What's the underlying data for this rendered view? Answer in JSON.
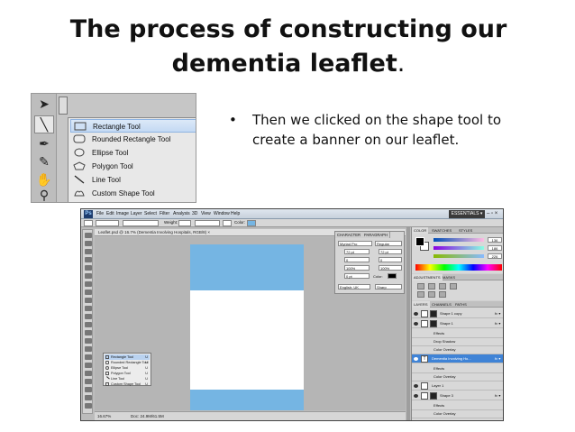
{
  "slide": {
    "title_line1": "The process of constructing our",
    "title_line2": "dementia leaflet",
    "title_period": ".",
    "bullet_marker": "•",
    "bullet_text": "Then we clicked on the shape tool to create a banner on our leaflet."
  },
  "shape_flyout": {
    "items": [
      {
        "label": "Rectangle Tool",
        "key": "U",
        "icon": "rectangle-icon",
        "selected": true
      },
      {
        "label": "Rounded Rectangle Tool",
        "key": "U",
        "icon": "rounded-rectangle-icon",
        "selected": false
      },
      {
        "label": "Ellipse Tool",
        "key": "U",
        "icon": "ellipse-icon",
        "selected": false
      },
      {
        "label": "Polygon Tool",
        "key": "U",
        "icon": "polygon-icon",
        "selected": false
      },
      {
        "label": "Line Tool",
        "key": "U",
        "icon": "line-icon",
        "selected": false
      },
      {
        "label": "Custom Shape Tool",
        "key": "U",
        "icon": "custom-shape-icon",
        "selected": false
      }
    ],
    "tool_icons": [
      "arrow-icon",
      "pen-icon",
      "line-tool-icon",
      "brush-icon",
      "hand-icon",
      "zoom-icon"
    ]
  },
  "photoshop": {
    "logo": "Ps",
    "menus": [
      "File",
      "Edit",
      "Image",
      "Layer",
      "Select",
      "Filter",
      "Analysis",
      "3D",
      "View",
      "Window",
      "Help"
    ],
    "workspace": "ESSENTIALS ▾",
    "window_controls": "– ▫ ×",
    "options": {
      "weight_label": "Weight:",
      "color_label": "Color:"
    },
    "doc_tab": "Leaflet.psd @ 16.7% (Dementia Involving Hospitals, RGB/8) ×",
    "status": {
      "zoom": "16.67%",
      "doc": "Doc: 24.9M/61.5M"
    },
    "flyout_items": [
      {
        "label": "Rectangle Tool",
        "key": "U"
      },
      {
        "label": "Rounded Rectangle Tool",
        "key": "U"
      },
      {
        "label": "Ellipse Tool",
        "key": "U"
      },
      {
        "label": "Polygon Tool",
        "key": "U"
      },
      {
        "label": "Line Tool",
        "key": "U"
      },
      {
        "label": "Custom Shape Tool",
        "key": "U"
      }
    ],
    "character_panel": {
      "tabs": [
        "CHARACTER",
        "PARAGRAPH"
      ],
      "font": "Myriad Pro",
      "style": "Regular",
      "size": "72 pt",
      "leading": "72 pt",
      "kerning": "0",
      "tracking": "0",
      "vscale": "100%",
      "hscale": "100%",
      "baseline": "0 pt",
      "color_label": "Color:",
      "language": "English: UK",
      "aa": "Sharp"
    },
    "color_panel": {
      "tabs": [
        "COLOR",
        "SWATCHES",
        "STYLES"
      ],
      "r": "136",
      "g": "186",
      "b": "226",
      "accent": "#75b5e3"
    },
    "adjustments_tabs": [
      "ADJUSTMENTS",
      "MASKS"
    ],
    "layers_tabs": [
      "LAYERS",
      "CHANNELS",
      "PATHS"
    ],
    "layers": [
      {
        "name": "Shape 1 copy",
        "fx": "fx ▾",
        "sel": false,
        "sub": false
      },
      {
        "name": "Shape 1",
        "fx": "fx ▾",
        "sel": false,
        "sub": false
      },
      {
        "name": "Effects",
        "fx": "",
        "sel": false,
        "sub": true
      },
      {
        "name": "Drop Shadow",
        "fx": "",
        "sel": false,
        "sub": true
      },
      {
        "name": "Color Overlay",
        "fx": "",
        "sel": false,
        "sub": true
      },
      {
        "name": "Dementia Involving Ho...",
        "fx": "fx ▾",
        "sel": true,
        "sub": false
      },
      {
        "name": "Effects",
        "fx": "",
        "sel": false,
        "sub": true
      },
      {
        "name": "Color Overlay",
        "fx": "",
        "sel": false,
        "sub": true
      },
      {
        "name": "Layer 1",
        "fx": "",
        "sel": false,
        "sub": false
      },
      {
        "name": "Shape 3",
        "fx": "fx ▾",
        "sel": false,
        "sub": false
      },
      {
        "name": "Effects",
        "fx": "",
        "sel": false,
        "sub": true
      },
      {
        "name": "Color Overlay",
        "fx": "",
        "sel": false,
        "sub": true
      }
    ]
  }
}
